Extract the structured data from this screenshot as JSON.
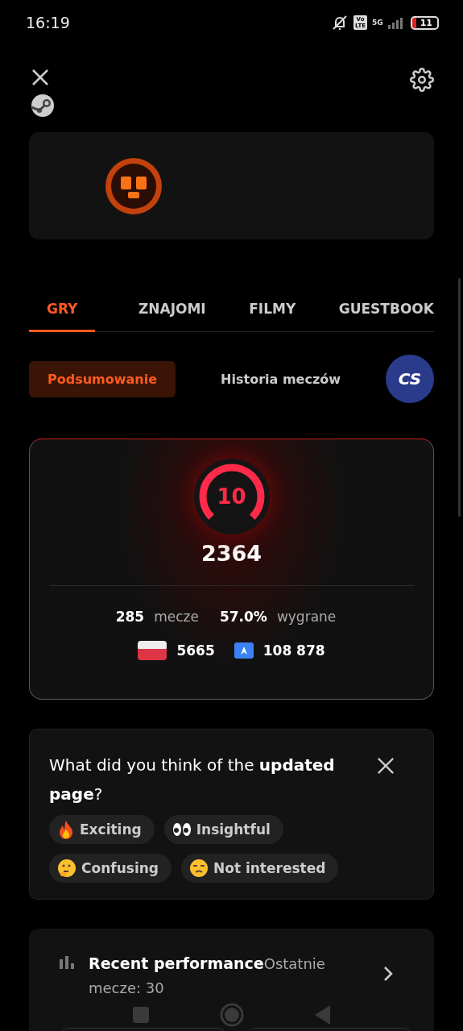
{
  "status_bar": {
    "time": "16:19",
    "volte": "Vo LTE",
    "network": "5G",
    "battery": "11"
  },
  "tabs": [
    {
      "label": "GRY",
      "selected": true
    },
    {
      "label": "ZNAJOMI",
      "selected": false
    },
    {
      "label": "FILMY",
      "selected": false
    },
    {
      "label": "GUESTBOOK",
      "selected": false
    }
  ],
  "subtabs": [
    {
      "label": "Podsumowanie",
      "selected": true
    },
    {
      "label": "Historia meczów",
      "selected": false
    }
  ],
  "game_badge": {
    "label": "CS"
  },
  "elo_card": {
    "level_number": "10",
    "elo": "2364",
    "matches": "285",
    "matches_label": "mecze",
    "winrate": "57.0%",
    "winrate_label": "wygrane",
    "country_rank": "5665",
    "region_rank": "108 878"
  },
  "feedback": {
    "question": "What did you think of the **updated page**?",
    "options": [
      {
        "kind": "fire",
        "label": "Exciting"
      },
      {
        "kind": "eyes",
        "label": "Insightful"
      },
      {
        "kind": "thinking",
        "label": "Confusing"
      },
      {
        "kind": "unamused",
        "label": "Not interested"
      }
    ]
  },
  "performance": {
    "title": "**Recent performance**Ostatnie mecze: 30"
  }
}
